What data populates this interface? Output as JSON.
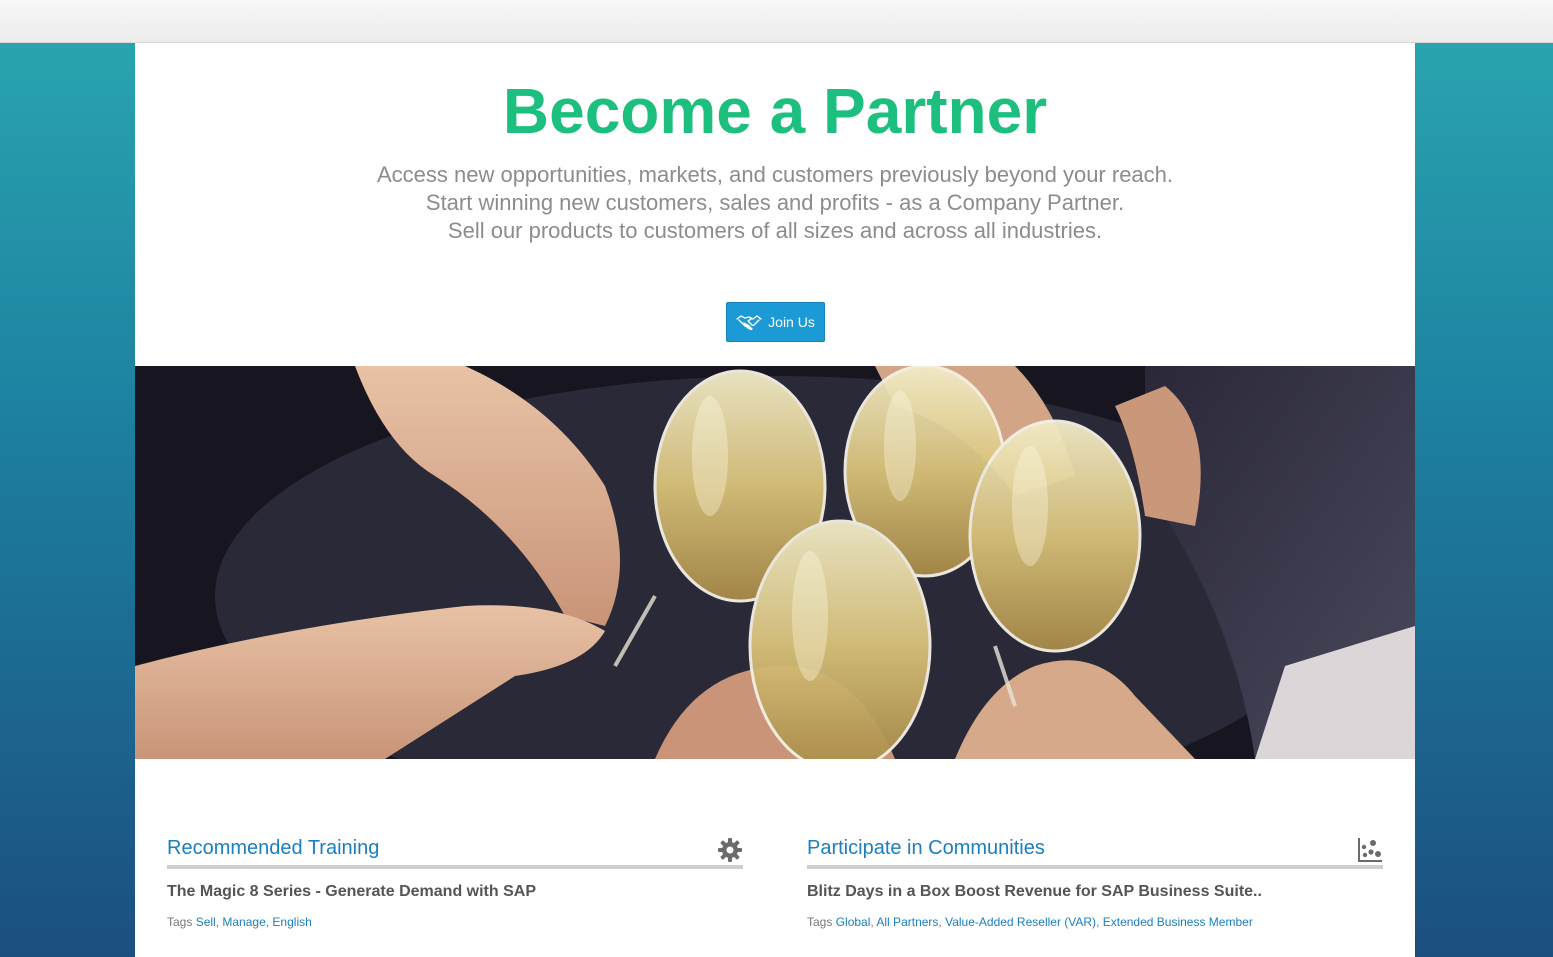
{
  "hero": {
    "title": "Become a Partner",
    "lines": [
      "Access new opportunities, markets, and customers previously beyond your reach.",
      "Start winning new customers, sales and profits - as a Company Partner.",
      "Sell our products to customers of all sizes and across all industries."
    ],
    "button_label": "Join Us",
    "button_icon": "handshake-icon"
  },
  "banner": {
    "image": "champagne-toast-photo"
  },
  "training": {
    "title": "Recommended Training",
    "icon": "gear-icon",
    "item_title": "The Magic 8 Series - Generate Demand with SAP",
    "tags_label": "Tags",
    "tags": [
      "Sell",
      "Manage",
      "English"
    ]
  },
  "communities": {
    "title": "Participate in Communities",
    "icon": "community-chart-icon",
    "item_title": "Blitz Days in a Box Boost Revenue for SAP Business Suite..",
    "tags_label": "Tags",
    "tags": [
      "Global",
      "All Partners",
      "Value-Added Reseller (VAR)",
      "Extended Business Member"
    ]
  },
  "colors": {
    "title_green": "#1dbf7f",
    "link_blue": "#1a7fc1",
    "button_blue": "#1b9ad6"
  }
}
